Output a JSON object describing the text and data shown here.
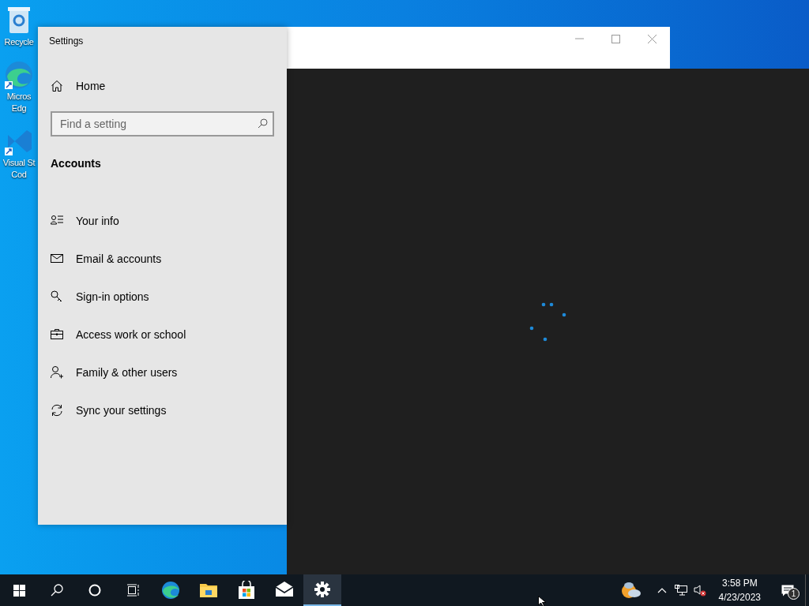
{
  "desktop_icons": [
    {
      "kind": "recycle",
      "lines": [
        "Recycle"
      ]
    },
    {
      "kind": "edge",
      "lines": [
        "Micros",
        "Edg"
      ]
    },
    {
      "kind": "vscode",
      "lines": [
        "Visual St",
        "Cod"
      ]
    }
  ],
  "window": {
    "title": "Settings",
    "home": "Home",
    "search": {
      "placeholder": "Find a setting"
    },
    "section": "Accounts",
    "nav_items": [
      {
        "kind": "info",
        "label": "Your info"
      },
      {
        "kind": "mail",
        "label": "Email & accounts"
      },
      {
        "kind": "key",
        "label": "Sign-in options"
      },
      {
        "kind": "briefcase",
        "label": "Access work or school"
      },
      {
        "kind": "family",
        "label": "Family & other users"
      },
      {
        "kind": "sync",
        "label": "Sync your settings"
      }
    ]
  },
  "taskbar": {
    "items": [
      {
        "kind": "start",
        "active": false
      },
      {
        "kind": "search",
        "active": false
      },
      {
        "kind": "cortana",
        "active": false
      },
      {
        "kind": "taskview",
        "active": false
      },
      {
        "kind": "edge",
        "active": false
      },
      {
        "kind": "explorer",
        "active": false
      },
      {
        "kind": "store",
        "active": false
      },
      {
        "kind": "mail",
        "active": false
      },
      {
        "kind": "settings",
        "active": true
      }
    ],
    "time": "3:58 PM",
    "date": "4/23/2023",
    "notifications": "1"
  }
}
